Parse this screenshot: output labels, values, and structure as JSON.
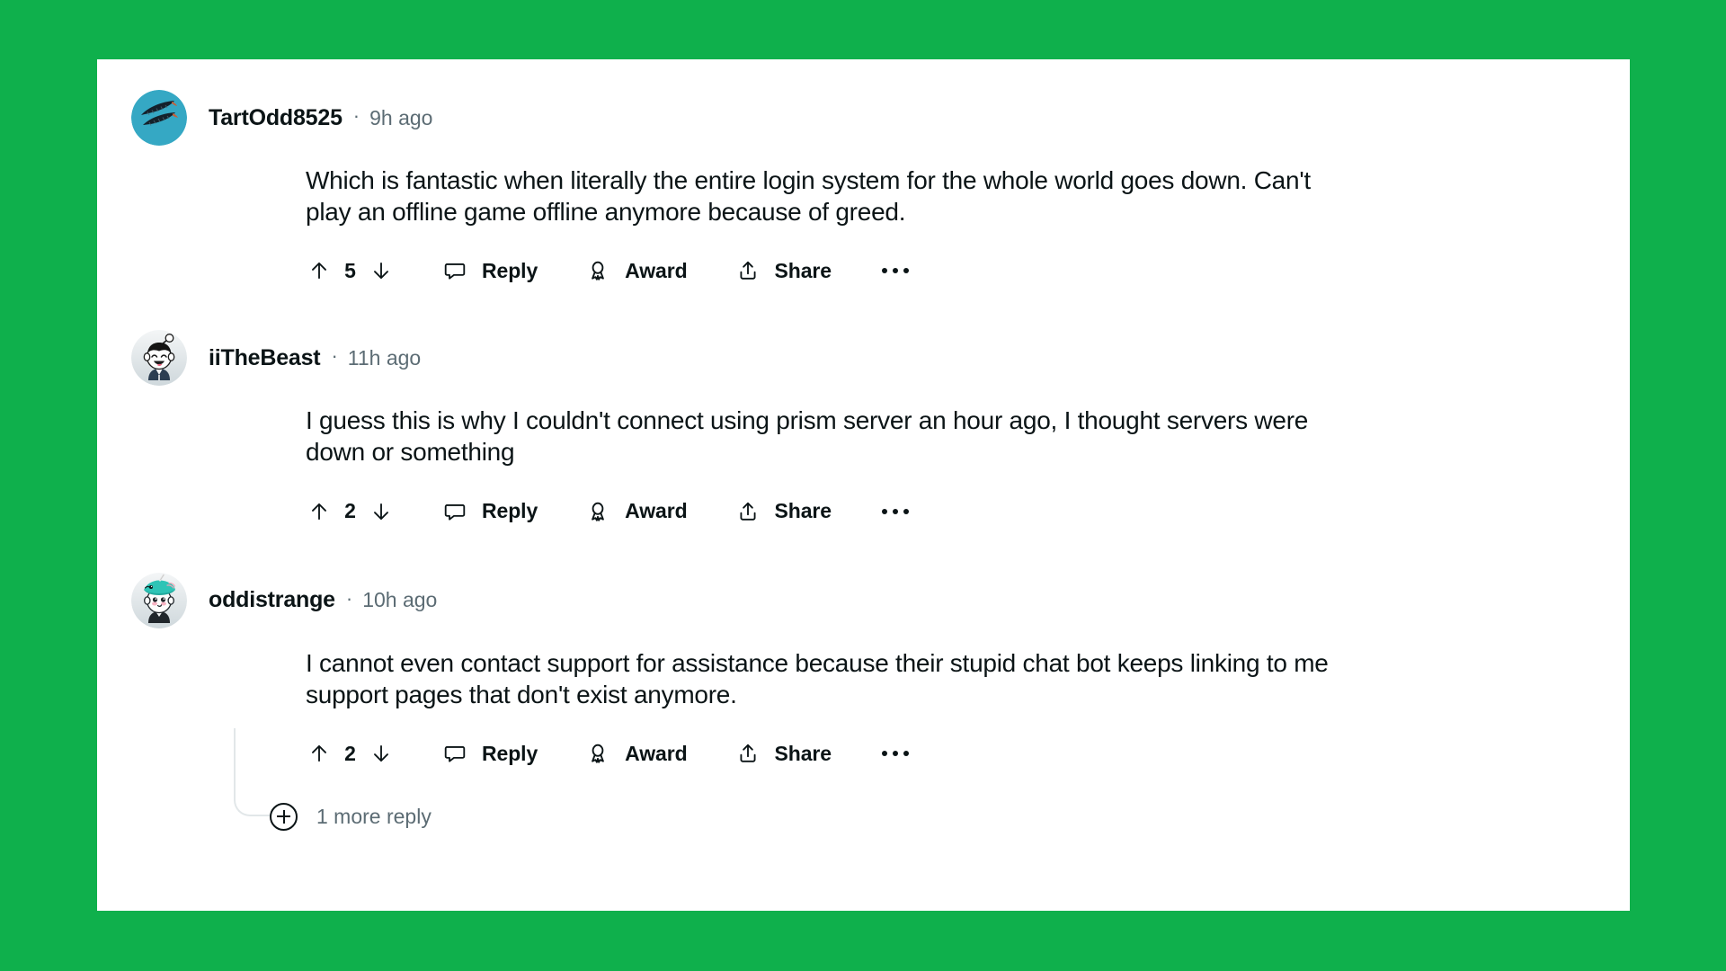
{
  "theme": {
    "background_color": "#0FB04C",
    "card_color": "#FFFFFF",
    "text_color": "#0B1416",
    "muted_text_color": "#5C6C74",
    "thread_line_color": "#E2E7E9"
  },
  "comments": [
    {
      "username": "TartOdd8525",
      "separator": "·",
      "timestamp": "9h ago",
      "body": "Which is fantastic when literally the entire login system for the whole world goes down. Can't play an offline game offline anymore because of greed.",
      "score": "5",
      "reply_label": "Reply",
      "award_label": "Award",
      "share_label": "Share",
      "avatar_type": "cyan-brows-avatar"
    },
    {
      "username": "iiTheBeast",
      "separator": "·",
      "timestamp": "11h ago",
      "body": "I guess this is why I couldn't connect using prism server an hour ago, I thought servers were down or something",
      "score": "2",
      "reply_label": "Reply",
      "award_label": "Award",
      "share_label": "Share",
      "avatar_type": "snoo-black-hair-avatar"
    },
    {
      "username": "oddistrange",
      "separator": "·",
      "timestamp": "10h ago",
      "body": "I cannot even contact support for assistance because their stupid chat bot keeps linking to me support pages that don't exist anymore.",
      "score": "2",
      "reply_label": "Reply",
      "award_label": "Award",
      "share_label": "Share",
      "avatar_type": "snoo-narwhal-hat-avatar"
    }
  ],
  "more_replies": {
    "label": "1 more reply"
  }
}
